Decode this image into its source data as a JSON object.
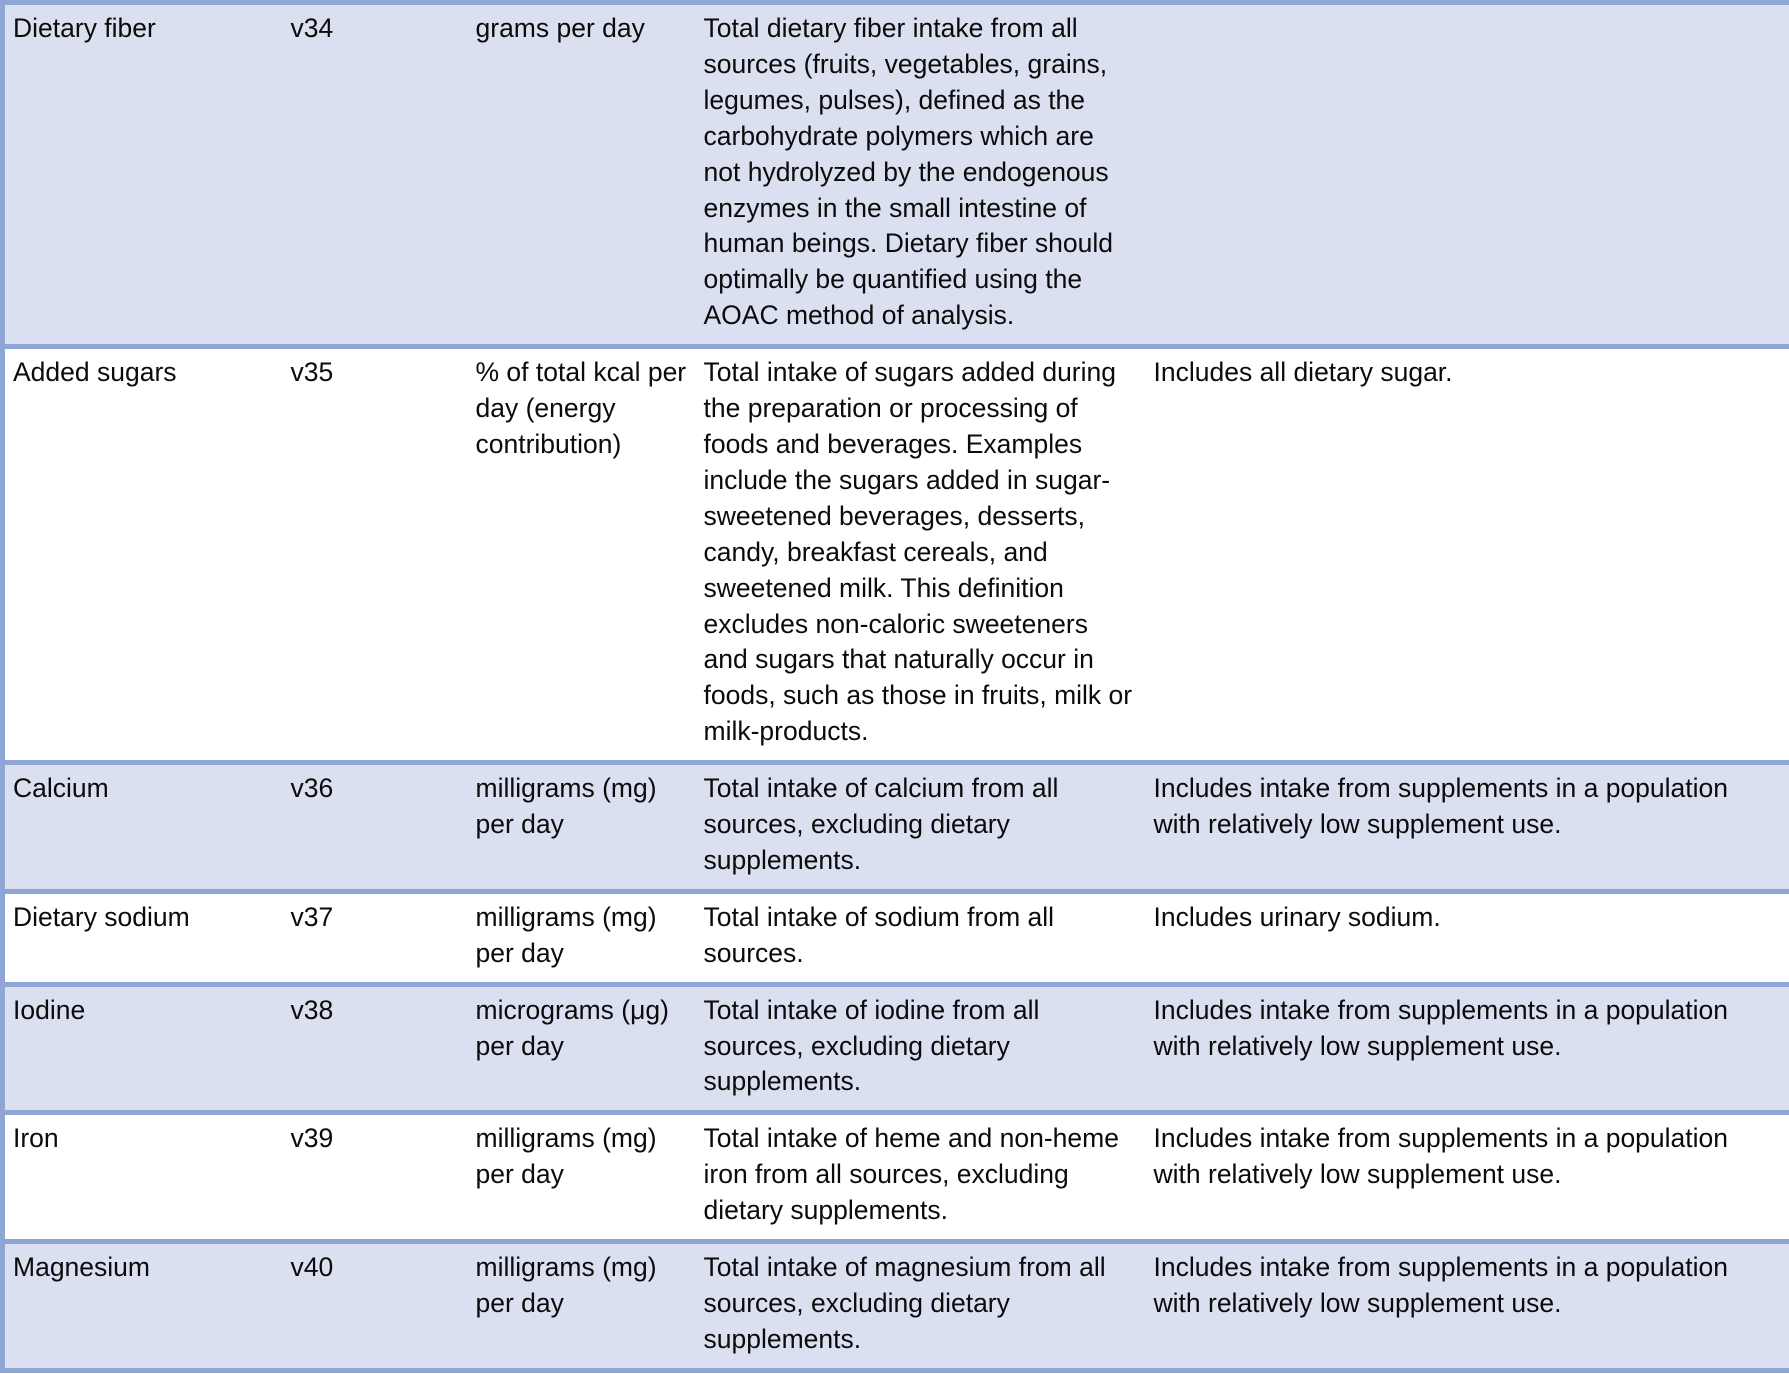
{
  "document": {
    "kind": "variable-definition-table",
    "accent_border_color": "#8fa5d4",
    "shaded_row_color": "#dbe0f0",
    "plain_row_color": "#ffffff",
    "text_color": "#0b0b0b"
  },
  "table": {
    "column_count": 5,
    "rows": [
      {
        "shaded": true,
        "name": "Dietary fiber",
        "code": "v34",
        "unit": "grams per day",
        "description": "Total dietary fiber intake from all sources (fruits, vegetables, grains, legumes, pulses), defined as the carbohydrate polymers which are not hydrolyzed by the endogenous enzymes in the small intestine of human beings. Dietary fiber should optimally be quantified using the AOAC method of analysis.",
        "notes": ""
      },
      {
        "shaded": false,
        "name": "Added sugars",
        "code": "v35",
        "unit": "% of total kcal per day (energy contribution)",
        "description": "Total intake of sugars added during the preparation or processing of foods and beverages.  Examples include the sugars added in sugar-sweetened beverages, desserts, candy, breakfast cereals, and sweetened milk.  This definition excludes non-caloric sweeteners and sugars that naturally occur in foods, such as those in fruits, milk or milk-products.",
        "notes": "Includes all dietary sugar."
      },
      {
        "shaded": true,
        "name": "Calcium",
        "code": "v36",
        "unit": "milligrams (mg) per day",
        "description": "Total intake of calcium from all sources, excluding dietary supplements.",
        "notes": "Includes intake from supplements in a population with relatively low supplement use."
      },
      {
        "shaded": false,
        "name": "Dietary sodium",
        "code": "v37",
        "unit": "milligrams (mg) per day",
        "description": "Total intake of sodium from all sources.",
        "notes": "Includes urinary sodium."
      },
      {
        "shaded": true,
        "name": "Iodine",
        "code": "v38",
        "unit": "micrograms (μg) per day",
        "description": "Total intake of iodine from all sources, excluding dietary supplements.",
        "notes": "Includes intake from supplements in a population with relatively low supplement use."
      },
      {
        "shaded": false,
        "name": "Iron",
        "code": "v39",
        "unit": "milligrams (mg) per day",
        "description": "Total intake of heme and non-heme iron from all sources, excluding dietary supplements.",
        "notes": "Includes intake from supplements in a population with relatively low supplement use."
      },
      {
        "shaded": true,
        "name": "Magnesium",
        "code": "v40",
        "unit": "milligrams (mg) per day",
        "description": "Total intake of magnesium from all sources, excluding dietary supplements.",
        "notes": "Includes intake from supplements in a population with relatively low supplement use."
      }
    ]
  }
}
